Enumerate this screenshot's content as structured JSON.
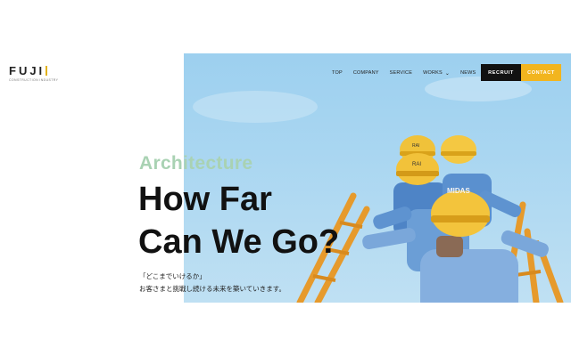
{
  "logo": {
    "name": "FUJI",
    "sub": "CONSTRUCTION INDUSTRY"
  },
  "nav": {
    "items": [
      {
        "label": "TOP"
      },
      {
        "label": "COMPANY"
      },
      {
        "label": "SERVICE"
      },
      {
        "label": "WORKS"
      },
      {
        "label": "NEWS"
      }
    ],
    "recruit": "RECRUIT",
    "contact": "CONTACT"
  },
  "hero": {
    "eyebrow": "Architecture",
    "headline_line1": "How Far",
    "headline_line2": "Can We Go?",
    "copy_line1": "「どこまでいけるか」",
    "copy_line2": "お客さまと挑戦し続ける未来を築いていきます。",
    "helmet_text_1": "MIDAS",
    "helmet_text_2": "RAI",
    "helmet_text_3": "RAI",
    "image_name": "workers-climbing-scaffold"
  },
  "colors": {
    "accent": "#f2b51e",
    "dark": "#111111",
    "eyebrow": "#a9d2b3",
    "sky": "#a9d6f1"
  }
}
